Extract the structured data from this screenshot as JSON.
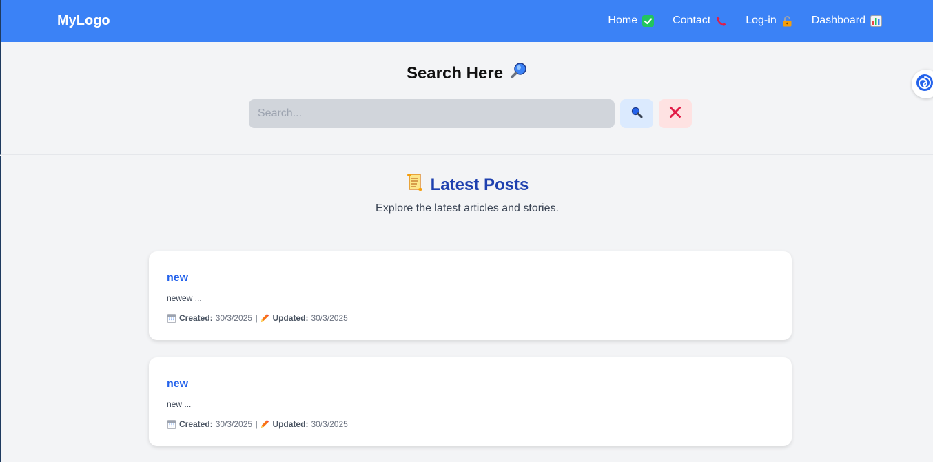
{
  "navbar": {
    "logo": "MyLogo",
    "links": [
      {
        "label": "Home",
        "icon": "check-icon"
      },
      {
        "label": "Contact",
        "icon": "phone-icon"
      },
      {
        "label": "Log-in",
        "icon": "lock-icon"
      },
      {
        "label": "Dashboard",
        "icon": "chart-icon"
      }
    ],
    "color": "#3b82f6"
  },
  "search": {
    "title": "Search Here",
    "title_icon": "magnifier-icon",
    "placeholder": "Search...",
    "value": "",
    "search_button_icon": "search-icon",
    "clear_button_icon": "close-icon"
  },
  "posts": {
    "title": "Latest Posts",
    "title_icon": "scroll-icon",
    "subtitle": "Explore the latest articles and stories.",
    "items": [
      {
        "title": "new",
        "excerpt": "newew ...",
        "created_label": "Created:",
        "created": "30/3/2025",
        "separator": "|",
        "updated_label": "Updated:",
        "updated": "30/3/2025"
      },
      {
        "title": "new",
        "excerpt": "new ...",
        "created_label": "Created:",
        "created": "30/3/2025",
        "separator": "|",
        "updated_label": "Updated:",
        "updated": "30/3/2025"
      }
    ]
  },
  "colors": {
    "accent": "#3b82f6",
    "heading_blue": "#1e40af",
    "link_blue": "#2563eb",
    "background": "#f3f4f6"
  }
}
